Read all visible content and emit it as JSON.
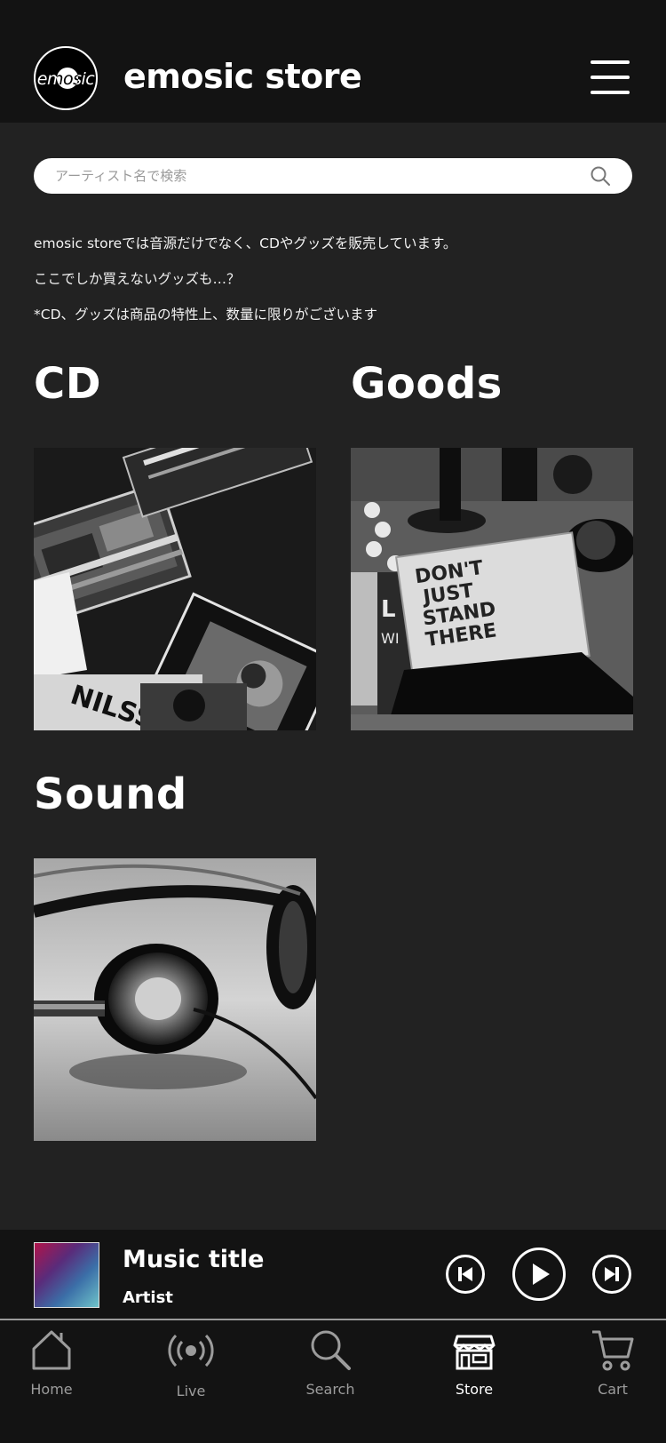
{
  "header": {
    "logo_text": "emosic",
    "title": "emosic store",
    "menu_icon": "hamburger-menu-icon"
  },
  "search": {
    "placeholder": "アーティスト名で検索",
    "icon": "search-icon"
  },
  "intro": {
    "line1": "emosic storeでは音源だけでなく、CDやグッズを販売しています。",
    "line2": "ここでしか買えないグッズも…？",
    "line3": "*CD、グッズは商品の特性上、数量に限りがございます"
  },
  "categories": [
    {
      "title": "CD",
      "image": "cd-stack-photo"
    },
    {
      "title": "Goods",
      "image": "goods-photo"
    },
    {
      "title": "Sound",
      "image": "headphones-photo"
    }
  ],
  "player": {
    "title": "Music title",
    "artist": "Artist"
  },
  "tabs": [
    {
      "label": "Home",
      "icon": "home-icon"
    },
    {
      "label": "Live",
      "icon": "live-broadcast-icon"
    },
    {
      "label": "Search",
      "icon": "search-icon"
    },
    {
      "label": "Store",
      "icon": "store-icon",
      "active": true
    },
    {
      "label": "Cart",
      "icon": "cart-icon"
    }
  ],
  "colors": {
    "background": "#222222",
    "header": "#131313",
    "text": "#ffffff",
    "inactive_tab": "#9c9c9c"
  }
}
